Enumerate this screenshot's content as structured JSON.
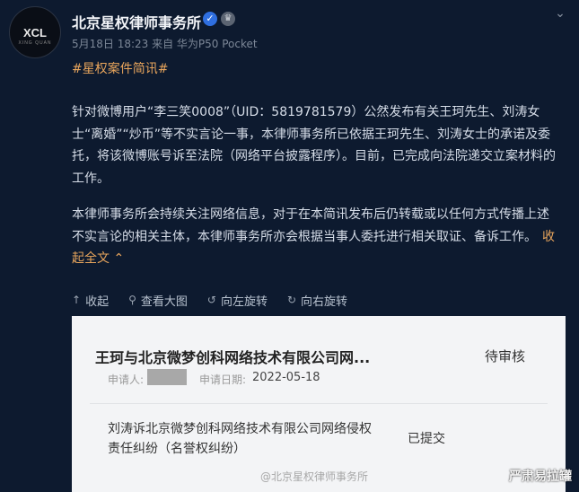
{
  "post": {
    "avatar_text": "XCL",
    "avatar_sub": "XING QUAN",
    "author": "北京星权律师事务所",
    "verified_icon": "✓",
    "meta": "5月18日 18:23 来自 华为P50 Pocket",
    "hashtag": "#星权案件简讯#",
    "paragraph1": "针对微博用户“李三笑0008”（UID：5819781579）公然发布有关王珂先生、刘涛女士“离婚”“炒币”等不实言论一事，本律师事务所已依据王珂先生、刘涛女士的承诺及委托，将该微博账号诉至法院（网络平台披露程序）。目前，已完成向法院递交立案材料的工作。",
    "paragraph2": "本律师事务所会持续关注网络信息，对于在本简讯发布后仍转载或以任何方式传播上述不实言论的相关主体，本律师事务所亦会根据当事人委托进行相关取证、备诉工作。",
    "collapse_label": "收起全文",
    "collapse_icon": "⌃"
  },
  "toolbar": {
    "collapse": "收起",
    "view_large": "查看大图",
    "rotate_left": "向左旋转",
    "rotate_right": "向右旋转"
  },
  "image_card": {
    "case1_title": "王珂与北京微梦创科网络技术有限公司网...",
    "case1_status": "待审核",
    "applicant_label": "申请人:",
    "date_label": "申请日期:",
    "date_value": "2022-05-18",
    "case2_title": "刘涛诉北京微梦创科网络技术有限公司网络侵权责任纠纷（名誉权纠纷）",
    "case2_status": "已提交",
    "watermark": "@北京星权律师事务所"
  },
  "corner_mark": "严肃易拉罐",
  "colors": {
    "background": "#0d1a2f",
    "link": "#e8a55c",
    "verified": "#2f6fe0"
  }
}
